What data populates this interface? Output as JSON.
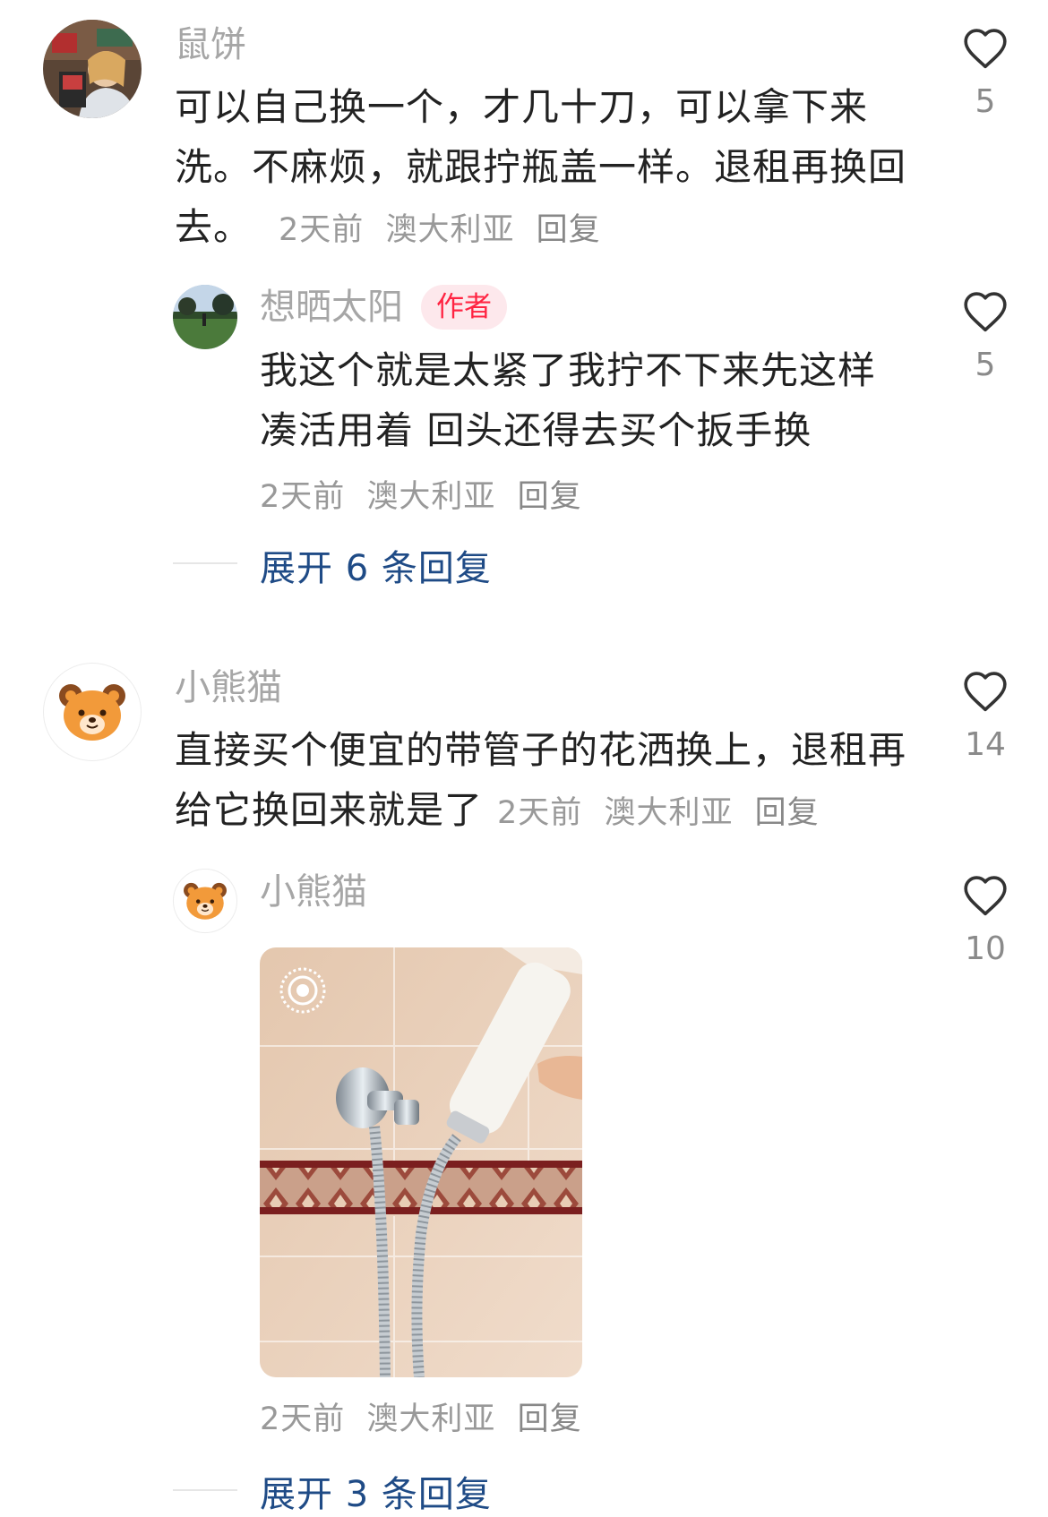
{
  "comments": [
    {
      "user": "鼠饼",
      "text_lines": [
        "可以自己换一个，才几十刀，可以拿下来",
        "洗。不麻烦，就跟拧瓶盖一样。退租再换回",
        "去。"
      ],
      "time": "2天前",
      "location": "澳大利亚",
      "reply_label": "回复",
      "likes": "5",
      "replies": [
        {
          "user": "想晒太阳",
          "badge": "作者",
          "text_lines": [
            "我这个就是太紧了我拧不下来先这样",
            "凑活用着 回头还得去买个扳手换"
          ],
          "time": "2天前",
          "location": "澳大利亚",
          "reply_label": "回复",
          "likes": "5"
        }
      ],
      "expand_label": "展开 6 条回复"
    },
    {
      "user": "小熊猫",
      "text_lines": [
        "直接买个便宜的带管子的花洒换上，退租再",
        "给它换回来就是了"
      ],
      "time": "2天前",
      "location": "澳大利亚",
      "reply_label": "回复",
      "likes": "14",
      "replies": [
        {
          "user": "小熊猫",
          "image_desc": "shower-hose-photo",
          "time": "2天前",
          "location": "澳大利亚",
          "reply_label": "回复",
          "likes": "10"
        }
      ],
      "expand_label": "展开 3 条回复"
    }
  ],
  "colors": {
    "accent_link": "#1f4b86",
    "author_badge": "#ff2442",
    "muted": "#a6a6a6"
  }
}
